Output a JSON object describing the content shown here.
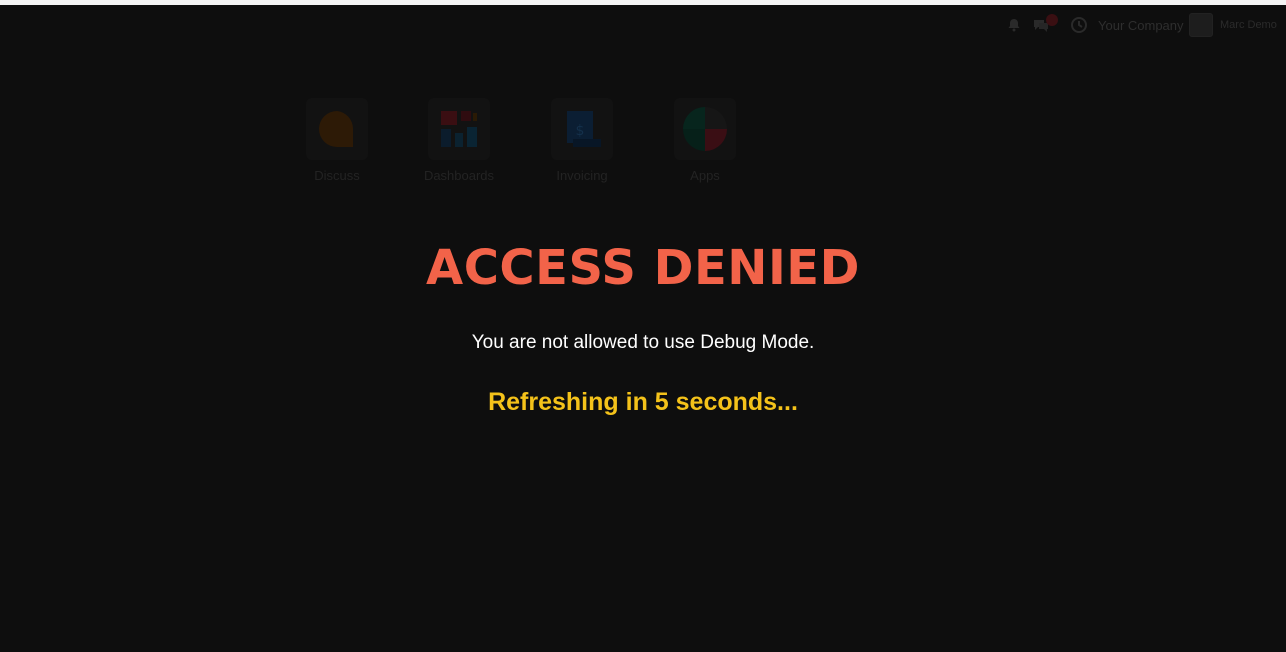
{
  "navbar": {
    "icons": {
      "bell": "bell-icon",
      "chat": "chat-icon",
      "clock": "clock-icon"
    },
    "chat_badge": "",
    "company": "Your Company",
    "user_name": "Marc Demo",
    "db_name": "",
    "avatar": "avatar"
  },
  "apps": [
    {
      "label": "Discuss",
      "icon": "discuss-icon"
    },
    {
      "label": "Dashboards",
      "icon": "dashboards-icon"
    },
    {
      "label": "Invoicing",
      "icon": "invoicing-icon"
    },
    {
      "label": "Apps",
      "icon": "apps-icon"
    }
  ],
  "overlay": {
    "title": "ACCESS DENIED",
    "message": "You are not allowed to use Debug Mode.",
    "refresh": "Refreshing in 5 seconds..."
  },
  "colors": {
    "background": "#0e0e0e",
    "title": "#f26349",
    "message": "#ffffff",
    "refresh": "#f4c21a"
  }
}
